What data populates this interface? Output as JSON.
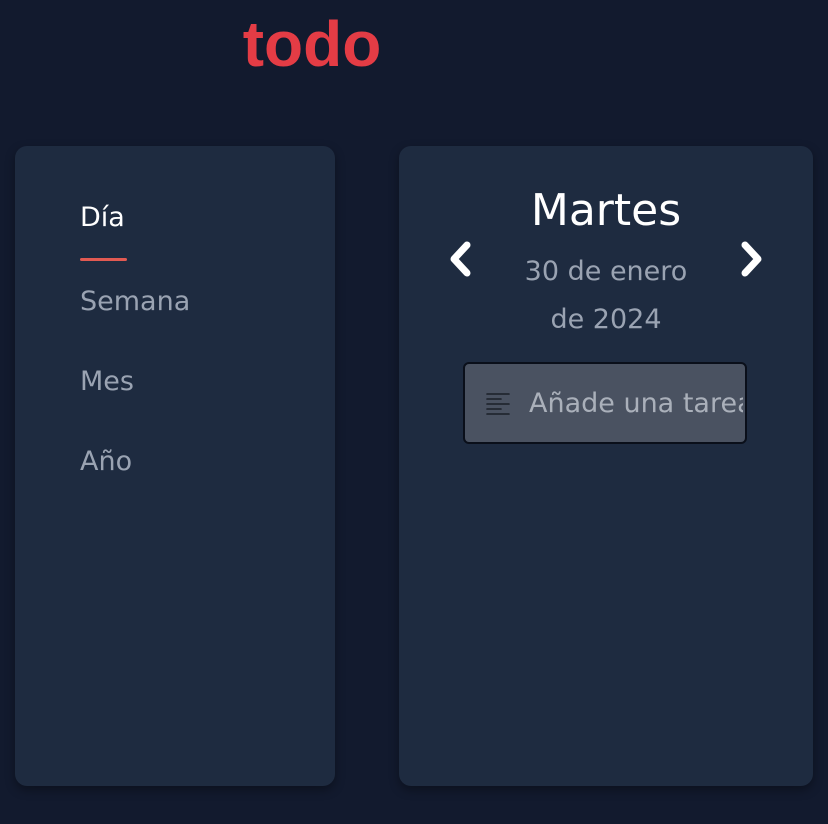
{
  "app": {
    "title": "todo",
    "accent_color": "#e43c45"
  },
  "nav": {
    "items": [
      {
        "label": "Día",
        "active": true
      },
      {
        "label": "Semana",
        "active": false
      },
      {
        "label": "Mes",
        "active": false
      },
      {
        "label": "Año",
        "active": false
      }
    ],
    "underline_color": "#e25a52"
  },
  "day_view": {
    "day_name": "Martes",
    "date_line_1": "30 de enero",
    "date_line_2": "de 2024",
    "prev_icon": "chevron-left-icon",
    "next_icon": "chevron-right-icon"
  },
  "task_input": {
    "placeholder": "Añade una tarea",
    "value": "",
    "icon": "align-left-icon"
  },
  "colors": {
    "background": "#121a2e",
    "card": "#1e2b40",
    "input_background": "#4a5261"
  }
}
